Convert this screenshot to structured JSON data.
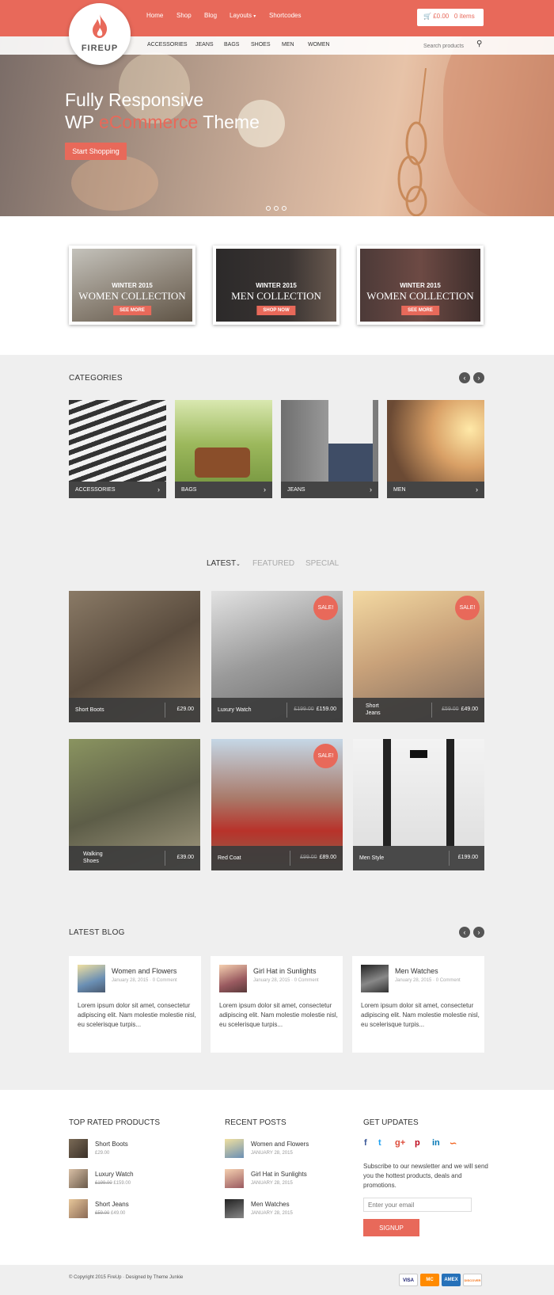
{
  "header": {
    "logo_text": "FIREUP",
    "nav": [
      "Home",
      "Shop",
      "Blog",
      "Layouts",
      "Shortcodes"
    ],
    "cart_amount": "£0.00",
    "cart_items": "0 items",
    "categories": [
      "ACCESSORIES",
      "JEANS",
      "BAGS",
      "SHOES",
      "MEN",
      "WOMEN"
    ],
    "search_placeholder": "Search products"
  },
  "hero": {
    "line1": "Fully Responsive",
    "line2_a": "WP ",
    "line2_b": "eCommerce",
    "line2_c": " Theme",
    "button": "Start Shopping"
  },
  "collections": [
    {
      "season": "WINTER 2015",
      "title": "WOMEN COLLECTION",
      "button": "SEE MORE"
    },
    {
      "season": "WINTER 2015",
      "title": "MEN COLLECTION",
      "button": "SHOP NOW"
    },
    {
      "season": "WINTER 2015",
      "title": "WOMEN COLLECTION",
      "button": "SEE MORE"
    }
  ],
  "categories_section": {
    "title": "CATEGORIES",
    "items": [
      "ACCESSORIES",
      "BAGS",
      "JEANS",
      "MEN"
    ]
  },
  "tabs": [
    "LATEST",
    "FEATURED",
    "SPECIAL"
  ],
  "products": [
    {
      "name": "Short Boots",
      "old_price": "",
      "price": "£29.00",
      "sale": ""
    },
    {
      "name": "Luxury Watch",
      "old_price": "£199.00",
      "price": "£159.00",
      "sale": "SALE!"
    },
    {
      "name": "Short Jeans",
      "old_price": "£59.00",
      "price": "£49.00",
      "sale": "SALE!"
    },
    {
      "name": "Walking Shoes",
      "old_price": "",
      "price": "£39.00",
      "sale": ""
    },
    {
      "name": "Red Coat",
      "old_price": "£99.00",
      "price": "£89.00",
      "sale": "SALE!"
    },
    {
      "name": "Men Style",
      "old_price": "",
      "price": "£199.00",
      "sale": ""
    }
  ],
  "blog": {
    "title": "LATEST BLOG",
    "posts": [
      {
        "title": "Women and Flowers",
        "date": "January 28, 2015 · 0 Comment",
        "excerpt": "Lorem ipsum dolor sit amet, consectetur adipiscing elit. Nam molestie molestie nisl, eu scelerisque turpis..."
      },
      {
        "title": "Girl Hat in Sunlights",
        "date": "January 28, 2015 · 0 Comment",
        "excerpt": "Lorem ipsum dolor sit amet, consectetur adipiscing elit. Nam molestie molestie nisl, eu scelerisque turpis..."
      },
      {
        "title": "Men Watches",
        "date": "January 28, 2015 · 0 Comment",
        "excerpt": "Lorem ipsum dolor sit amet, consectetur adipiscing elit. Nam molestie molestie nisl, eu scelerisque turpis..."
      }
    ]
  },
  "footer": {
    "top_rated_title": "TOP RATED PRODUCTS",
    "top_rated": [
      {
        "name": "Short Boots",
        "old_price": "",
        "price": "£29.00"
      },
      {
        "name": "Luxury Watch",
        "old_price": "£199.00",
        "price": "£159.00"
      },
      {
        "name": "Short Jeans",
        "old_price": "£59.00",
        "price": "£49.00"
      }
    ],
    "recent_title": "RECENT POSTS",
    "recent": [
      {
        "title": "Women and Flowers",
        "date": "JANUARY 28, 2015"
      },
      {
        "title": "Girl Hat in Sunlights",
        "date": "JANUARY 28, 2015"
      },
      {
        "title": "Men Watches",
        "date": "JANUARY 28, 2015"
      }
    ],
    "updates_title": "GET UPDATES",
    "updates_text": "Subscribe to our newsletter and we will send you the hottest products, deals and promotions.",
    "email_placeholder": "Enter your email",
    "signup": "SIGNUP",
    "copyright": "© Copyright 2015 FireUp · Designed by Theme Junkie",
    "cards": [
      "VISA",
      "MC",
      "AMEX",
      "DISCOVER"
    ]
  },
  "colors": {
    "accent": "#e8695a",
    "dark_bar": "#444444",
    "gray_bg": "#efefef"
  }
}
